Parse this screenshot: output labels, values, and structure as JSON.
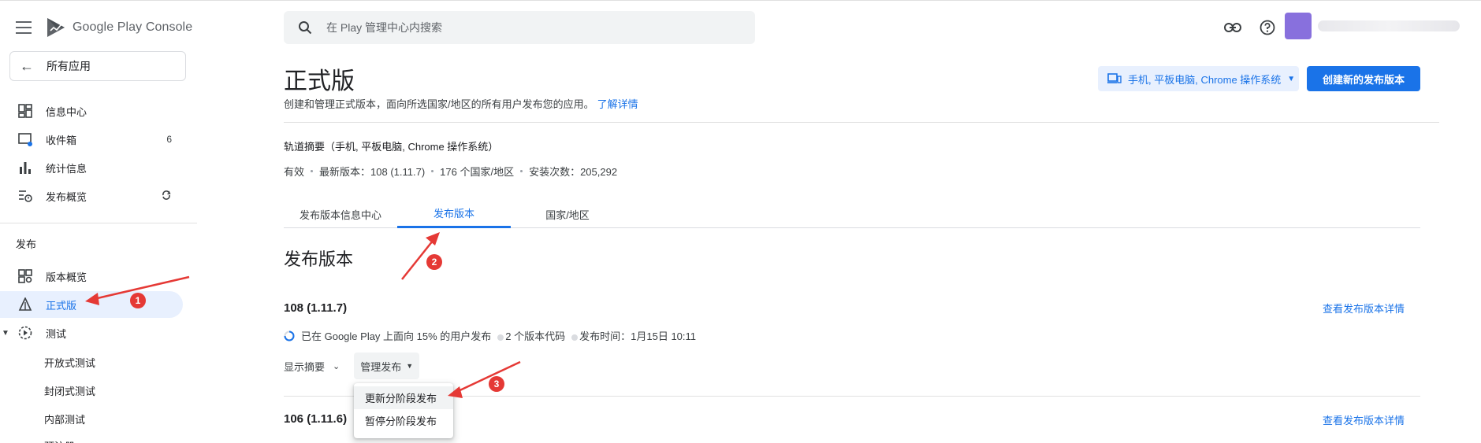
{
  "app": {
    "brand_google": "Google Play",
    "brand_console": "Console"
  },
  "sidebar": {
    "all_apps": "所有应用",
    "items": [
      {
        "label": "信息中心",
        "icon": "dashboard-icon"
      },
      {
        "label": "收件箱",
        "icon": "inbox-icon",
        "badge": "6"
      },
      {
        "label": "统计信息",
        "icon": "bar-chart-icon"
      },
      {
        "label": "发布概览",
        "icon": "publishing-overview-icon",
        "badge_icon": "sync-icon"
      }
    ],
    "section_label": "发布",
    "release_items": [
      {
        "label": "版本概览",
        "icon": "release-overview-icon"
      },
      {
        "label": "正式版",
        "icon": "production-icon",
        "active": true
      },
      {
        "label": "测试",
        "icon": "testing-icon"
      }
    ],
    "sub_items": [
      "开放式测试",
      "封闭式测试",
      "内部测试"
    ],
    "partial_item": "预注册"
  },
  "search": {
    "placeholder": "在 Play 管理中心内搜索"
  },
  "header": {
    "title": "正式版",
    "description": "创建和管理正式版本，面向所选国家/地区的所有用户发布您的应用。",
    "learn_more": "了解详情",
    "device_select": "手机, 平板电脑, Chrome 操作系统",
    "create_button": "创建新的发布版本"
  },
  "track": {
    "title": "轨道摘要（手机, 平板电脑, Chrome 操作系统）",
    "meta": [
      "有效",
      "最新版本：108 (1.11.7)",
      "176 个国家/地区",
      "安装次数：205,292"
    ]
  },
  "tabs": [
    "发布版本信息中心",
    "发布版本",
    "国家/地区"
  ],
  "section_title": "发布版本",
  "releases": [
    {
      "version": "108 (1.11.7)",
      "link": "查看发布版本详情",
      "status": "已在 Google Play 上面向 15% 的用户发布",
      "codes": "2 个版本代码",
      "time": "发布时间：1月15日 10:11"
    },
    {
      "version": "106 (1.11.6)",
      "link": "查看发布版本详情"
    }
  ],
  "actions": {
    "show_summary": "显示摘要",
    "manage": "管理发布"
  },
  "menu": [
    "更新分阶段发布",
    "暂停分阶段发布"
  ],
  "annotations": [
    "1",
    "2",
    "3"
  ],
  "colors": {
    "accent": "#1a73e8",
    "active_bg": "#e8f0fe",
    "annotation": "#e53935"
  }
}
